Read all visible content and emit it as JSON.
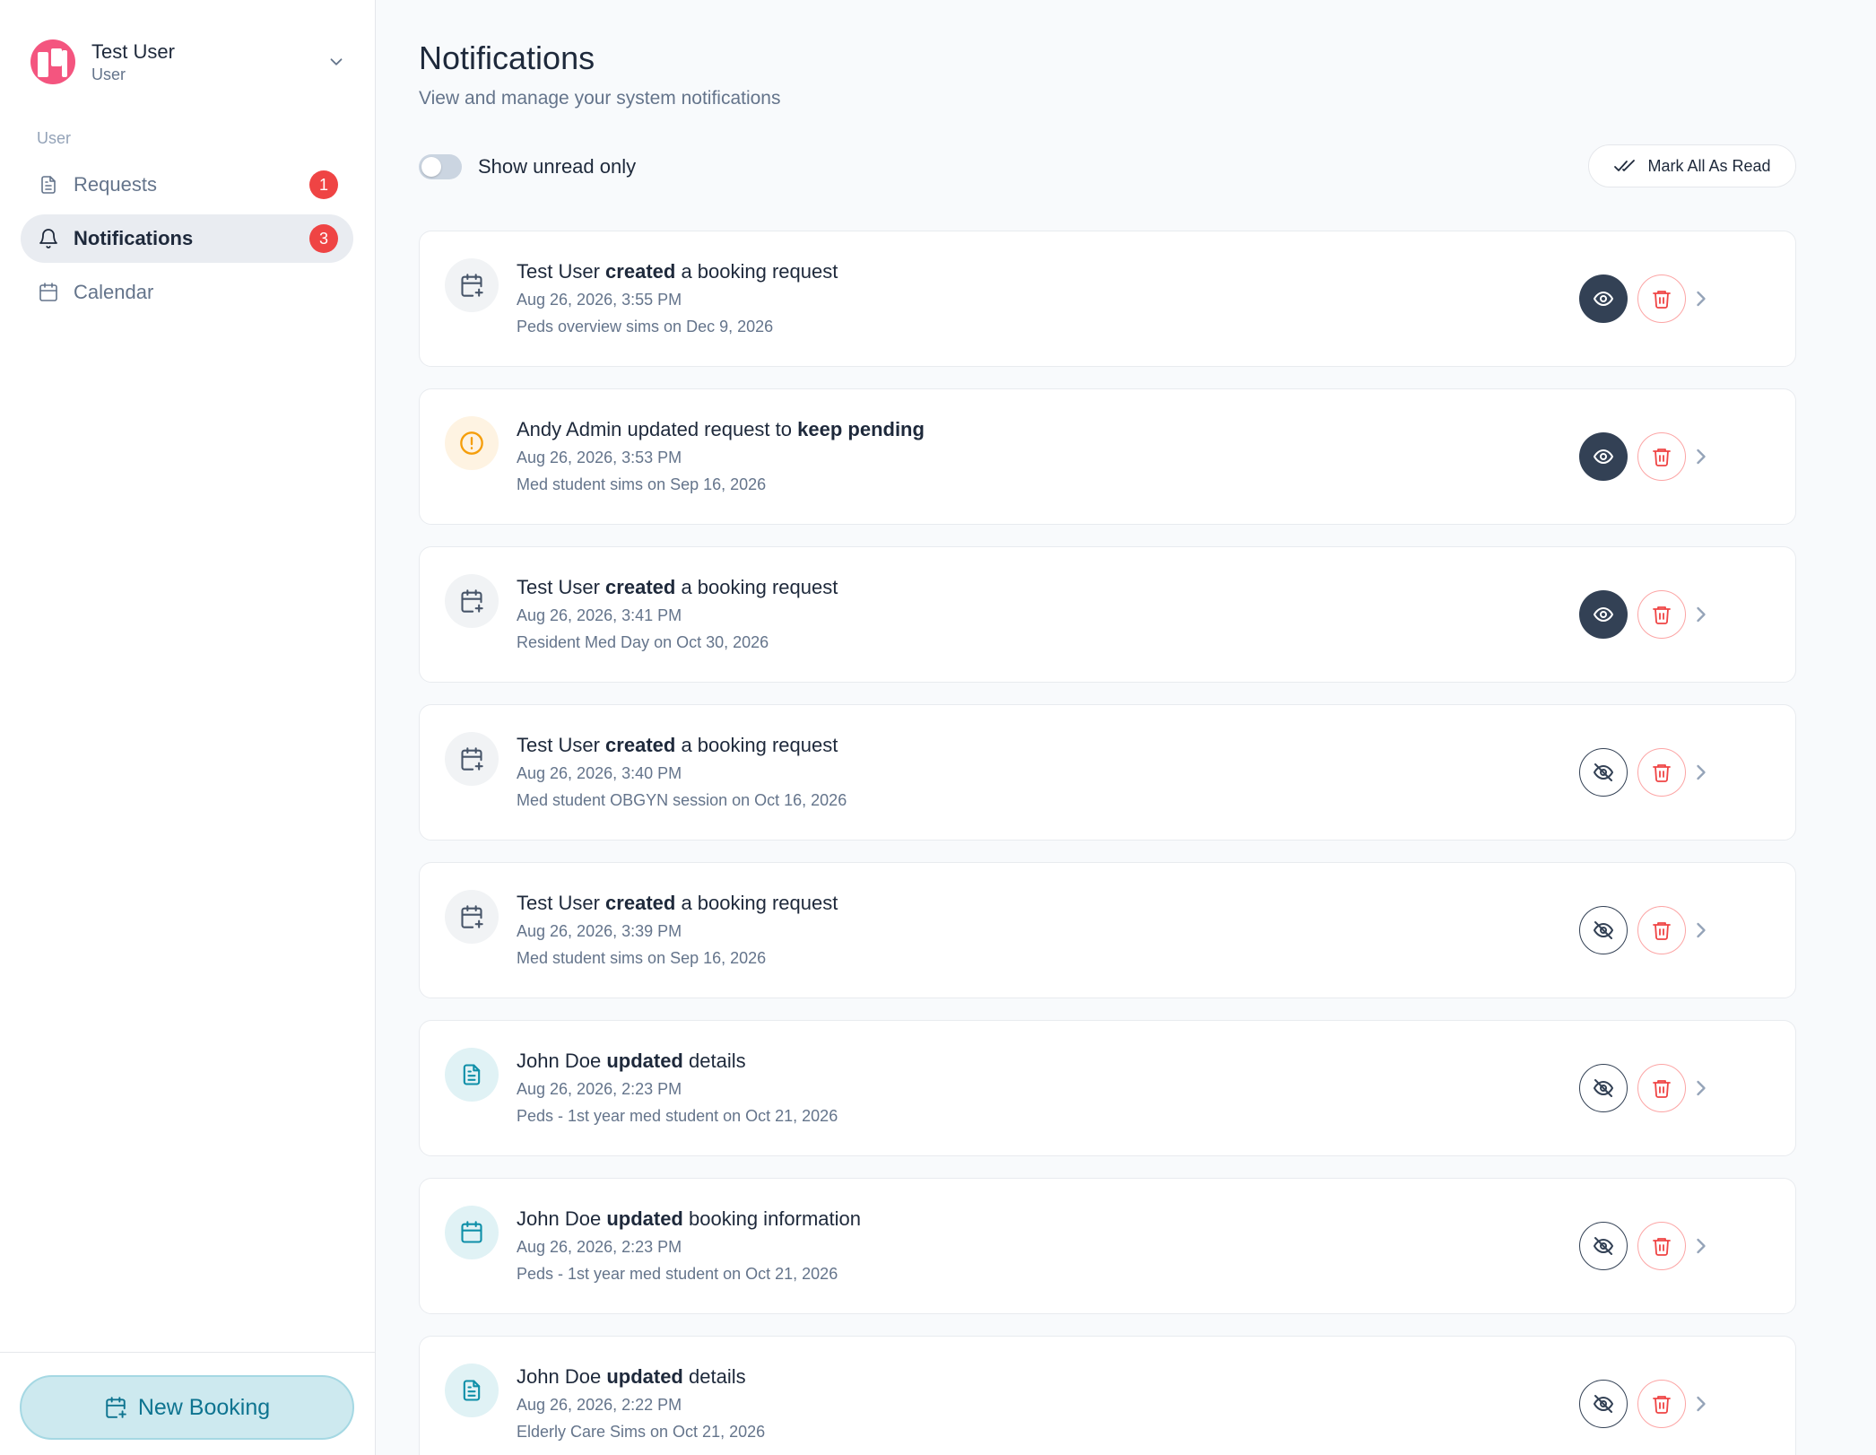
{
  "user": {
    "name": "Test User",
    "role": "User"
  },
  "sidebar": {
    "section_label": "User",
    "items": [
      {
        "label": "Requests",
        "badge": "1"
      },
      {
        "label": "Notifications",
        "badge": "3"
      },
      {
        "label": "Calendar"
      }
    ],
    "new_booking_label": "New Booking"
  },
  "header": {
    "title": "Notifications",
    "subtitle": "View and manage your system notifications",
    "toggle_label": "Show unread only",
    "mark_all_label": "Mark All As Read"
  },
  "notifications": [
    {
      "actor": "Test User",
      "action": "created",
      "suffix": "a booking request",
      "time": "Aug 26, 2026, 3:55 PM",
      "detail": "Peds overview sims on Dec 9, 2026"
    },
    {
      "actor": "Andy Admin",
      "prefix": "updated request to",
      "action": "keep pending",
      "time": "Aug 26, 2026, 3:53 PM",
      "detail": "Med student sims on Sep 16, 2026"
    },
    {
      "actor": "Test User",
      "action": "created",
      "suffix": "a booking request",
      "time": "Aug 26, 2026, 3:41 PM",
      "detail": "Resident Med Day on Oct 30, 2026"
    },
    {
      "actor": "Test User",
      "action": "created",
      "suffix": "a booking request",
      "time": "Aug 26, 2026, 3:40 PM",
      "detail": "Med student OBGYN session on Oct 16, 2026"
    },
    {
      "actor": "Test User",
      "action": "created",
      "suffix": "a booking request",
      "time": "Aug 26, 2026, 3:39 PM",
      "detail": "Med student sims on Sep 16, 2026"
    },
    {
      "actor": "John Doe",
      "action": "updated",
      "suffix": "details",
      "time": "Aug 26, 2026, 2:23 PM",
      "detail": "Peds - 1st year med student on Oct 21, 2026"
    },
    {
      "actor": "John Doe",
      "action": "updated",
      "suffix": "booking information",
      "time": "Aug 26, 2026, 2:23 PM",
      "detail": "Peds - 1st year med student on Oct 21, 2026"
    },
    {
      "actor": "John Doe",
      "action": "updated",
      "suffix": "details",
      "time": "Aug 26, 2026, 2:22 PM",
      "detail": "Elderly Care Sims on Oct 21, 2026"
    }
  ],
  "icons": {
    "user_menu": "chevron-down-icon",
    "requests": "document-icon",
    "notifications": "bell-icon",
    "calendar": "calendar-icon",
    "new_booking": "calendar-plus-icon",
    "mark_all": "double-check-icon",
    "unread": "eye-icon",
    "read": "eye-off-icon",
    "delete": "trash-icon",
    "open": "chevron-right-icon"
  },
  "colors": {
    "accent": "#0e7490",
    "badge": "#ef4444",
    "avatar": "#f4557f",
    "dark": "#334155"
  }
}
